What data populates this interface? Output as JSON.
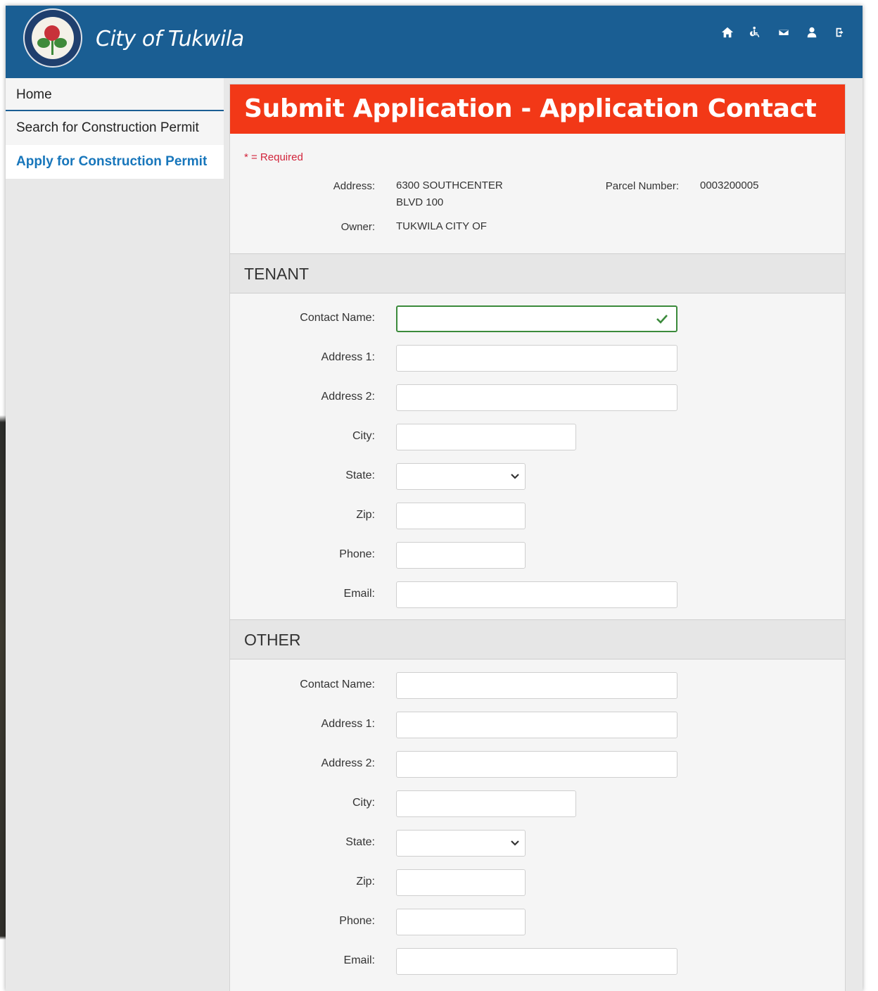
{
  "header": {
    "brand": "City of Tukwila",
    "seal_icon": "city-seal-icon",
    "icons": [
      "home-icon",
      "accessibility-icon",
      "mail-icon",
      "user-icon",
      "logout-icon"
    ],
    "color": "#1a5e93"
  },
  "sidebar": {
    "items": [
      {
        "label": "Home"
      },
      {
        "label": "Search for Construction Permit"
      },
      {
        "label": "Apply for Construction Permit",
        "active": true
      }
    ]
  },
  "main": {
    "title": "Submit Application - Application Contact",
    "title_color": "#f23817",
    "required_note": "* = Required",
    "info": {
      "address_label": "Address:",
      "address_line1": "6300 SOUTHCENTER",
      "address_line2": "BLVD 100",
      "owner_label": "Owner:",
      "owner_value": "TUKWILA CITY OF",
      "parcel_label": "Parcel Number:",
      "parcel_value": "0003200005"
    },
    "tenant": {
      "heading": "TENANT",
      "contact_name": "Contact Name:",
      "address1": "Address 1:",
      "address2": "Address 2:",
      "city": "City:",
      "state": "State:",
      "zip": "Zip:",
      "phone": "Phone:",
      "email": "Email:"
    },
    "other": {
      "heading": "OTHER",
      "contact_name": "Contact Name:",
      "address1": "Address 1:",
      "address2": "Address 2:",
      "city": "City:",
      "state": "State:",
      "zip": "Zip:",
      "phone": "Phone:",
      "email": "Email:"
    }
  }
}
